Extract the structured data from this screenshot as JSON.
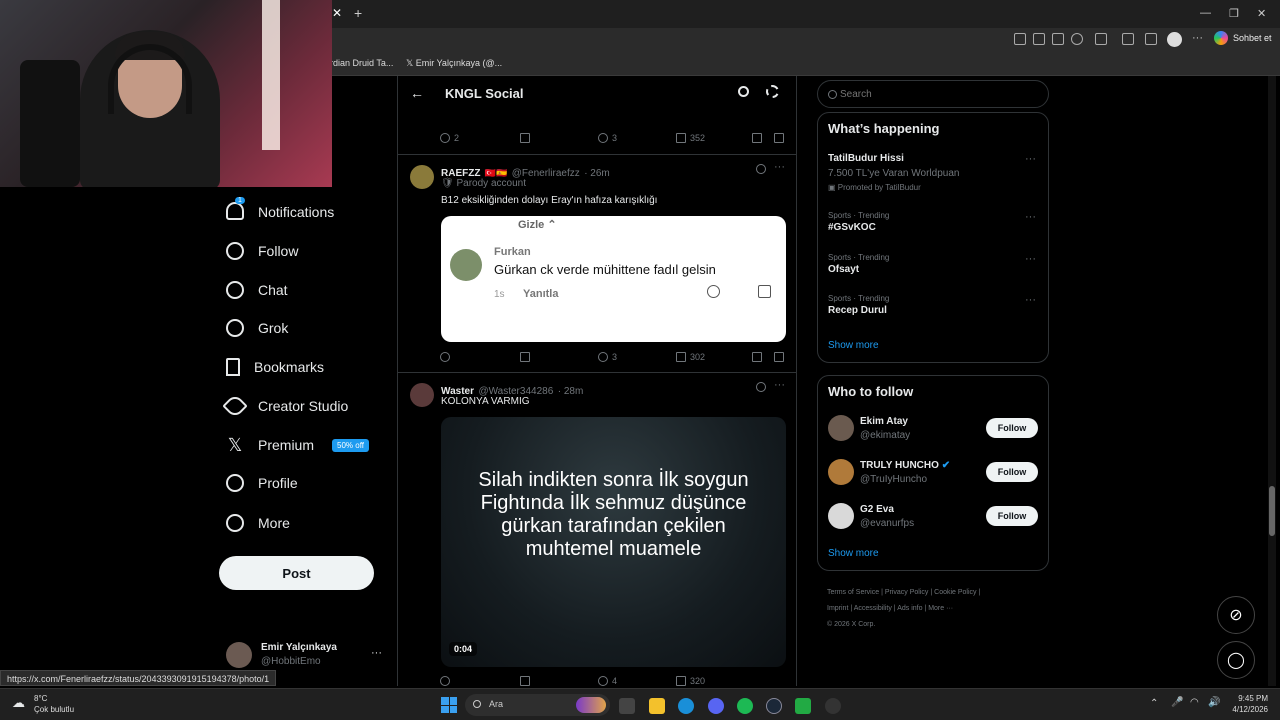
{
  "browser": {
    "bookmarks": [
      "rdian Druid Ta...",
      "Emir Yalçınkaya (@..."
    ],
    "profile_button": "Sohbet et"
  },
  "status_url": "https://x.com/Fenerliraefzz/status/2043393091915194378/photo/1",
  "nav": {
    "items": [
      "Notifications",
      "Follow",
      "Chat",
      "Grok",
      "Bookmarks",
      "Creator Studio",
      "Premium",
      "Profile",
      "More"
    ],
    "premium_badge": "50% off",
    "notification_count": "1",
    "post_label": "Post",
    "account_name": "Emir Yalçınkaya",
    "account_handle": "@HobbitEmo"
  },
  "community": {
    "title": "KNGL Social"
  },
  "top_tweet_actions": {
    "replies": "2",
    "likes": "3",
    "views": "352"
  },
  "tweet1": {
    "name": "RAEFZZ",
    "handle": "@Fenerliraefzz",
    "time": "· 26m",
    "label": "Parody account",
    "text": "B12 eksikliğinden dolayı Eray'ın hafıza karışıklığı",
    "embed": {
      "hide_label": "Gizle",
      "author": "Furkan",
      "comment": "Gürkan ck verde mühittene fadıl gelsin",
      "age": "1s",
      "reply_label": "Yanıtla"
    },
    "likes": "3",
    "views": "302"
  },
  "tweet2": {
    "name": "Waster",
    "handle": "@Waster344286",
    "time": "· 28m",
    "text": "KOLONYA VARMIG",
    "video_caption": "Silah indikten sonra İlk soygun Fightında İlk sehmuz düşünce gürkan tarafından çekilen muhtemel muamele",
    "video_time": "0:04",
    "likes": "4",
    "views": "320"
  },
  "search": {
    "placeholder": "Search"
  },
  "whats_happening": {
    "title": "What’s happening",
    "promo_name": "TatilBudur Hissi",
    "promo_sub": "7.500 TL'ye Varan Worldpuan",
    "promo_by": "Promoted by TatilBudur",
    "trends": [
      {
        "meta": "Sports · Trending",
        "name": "#GSvKOC"
      },
      {
        "meta": "Sports · Trending",
        "name": "Ofsayt"
      },
      {
        "meta": "Sports · Trending",
        "name": "Recep Durul"
      }
    ],
    "show_more": "Show more"
  },
  "who_to_follow": {
    "title": "Who to follow",
    "users": [
      {
        "name": "Ekim Atay",
        "handle": "@ekimatay"
      },
      {
        "name": "TRULY HUNCHO",
        "handle": "@TruIyHuncho"
      },
      {
        "name": "G2 Eva",
        "handle": "@evanurfps"
      }
    ],
    "follow_label": "Follow",
    "show_more": "Show more"
  },
  "footer": {
    "links": [
      "Terms of Service",
      "Privacy Policy",
      "Cookie Policy",
      "Imprint",
      "Accessibility",
      "Ads info",
      "More ···"
    ],
    "copyright": "© 2026 X Corp."
  },
  "taskbar": {
    "weather_temp": "8°C",
    "weather_desc": "Çok bulutlu",
    "search_placeholder": "Ara",
    "time": "9:45 PM",
    "date": "4/12/2026"
  },
  "colors": {
    "accent": "#1d9bf0",
    "background": "#000000",
    "border": "#2f3336"
  }
}
